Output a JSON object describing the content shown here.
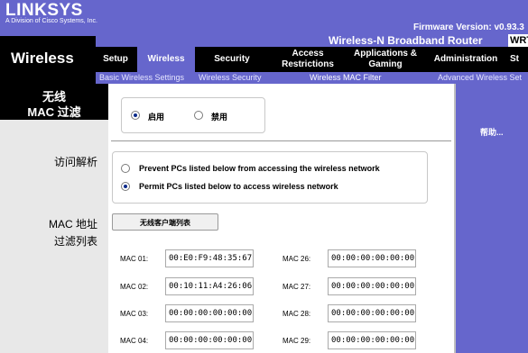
{
  "brand": {
    "logo": "LINKSYS",
    "sub": "A Division of Cisco Systems, Inc."
  },
  "firmware": "Firmware Version: v0.93.3",
  "product": {
    "name": "Wireless-N Broadband Router",
    "code": "WRT"
  },
  "page_title": "Wireless",
  "tabs": [
    {
      "label": "Setup"
    },
    {
      "label": "Wireless"
    },
    {
      "label": "Security"
    },
    {
      "label": "Access Restrictions"
    },
    {
      "label": "Applications & Gaming"
    },
    {
      "label": "Administration"
    },
    {
      "label": "St"
    }
  ],
  "subtabs": [
    {
      "label": "Basic Wireless Settings"
    },
    {
      "label": "Wireless Security"
    },
    {
      "label": "Wireless MAC Filter"
    },
    {
      "label": "Advanced Wireless Set"
    }
  ],
  "left": {
    "section_title_1": "无线",
    "section_title_2": "MAC 过滤",
    "access_label": "访问解析",
    "mac_list_label_1": "MAC 地址",
    "mac_list_label_2": "过滤列表"
  },
  "filter": {
    "enable_label": "启用",
    "disable_label": "禁用",
    "enabled": true
  },
  "access": {
    "prevent_label": "Prevent PCs listed below from accessing the wireless network",
    "permit_label": "Permit PCs listed below to access wireless network",
    "selected": "permit"
  },
  "edit_button": "无线客户端列表",
  "help": "帮助...",
  "mac_rows": [
    {
      "l_label": "MAC 01:",
      "l_value": "00:E0:F9:48:35:67",
      "r_label": "MAC 26:",
      "r_value": "00:00:00:00:00:00"
    },
    {
      "l_label": "MAC 02:",
      "l_value": "00:10:11:A4:26:06",
      "r_label": "MAC 27:",
      "r_value": "00:00:00:00:00:00"
    },
    {
      "l_label": "MAC 03:",
      "l_value": "00:00:00:00:00:00",
      "r_label": "MAC 28:",
      "r_value": "00:00:00:00:00:00"
    },
    {
      "l_label": "MAC 04:",
      "l_value": "00:00:00:00:00:00",
      "r_label": "MAC 29:",
      "r_value": "00:00:00:00:00:00"
    }
  ],
  "colors": {
    "header": "#6666cc",
    "strip": "#000000",
    "label_col": "#e8e8e8"
  }
}
